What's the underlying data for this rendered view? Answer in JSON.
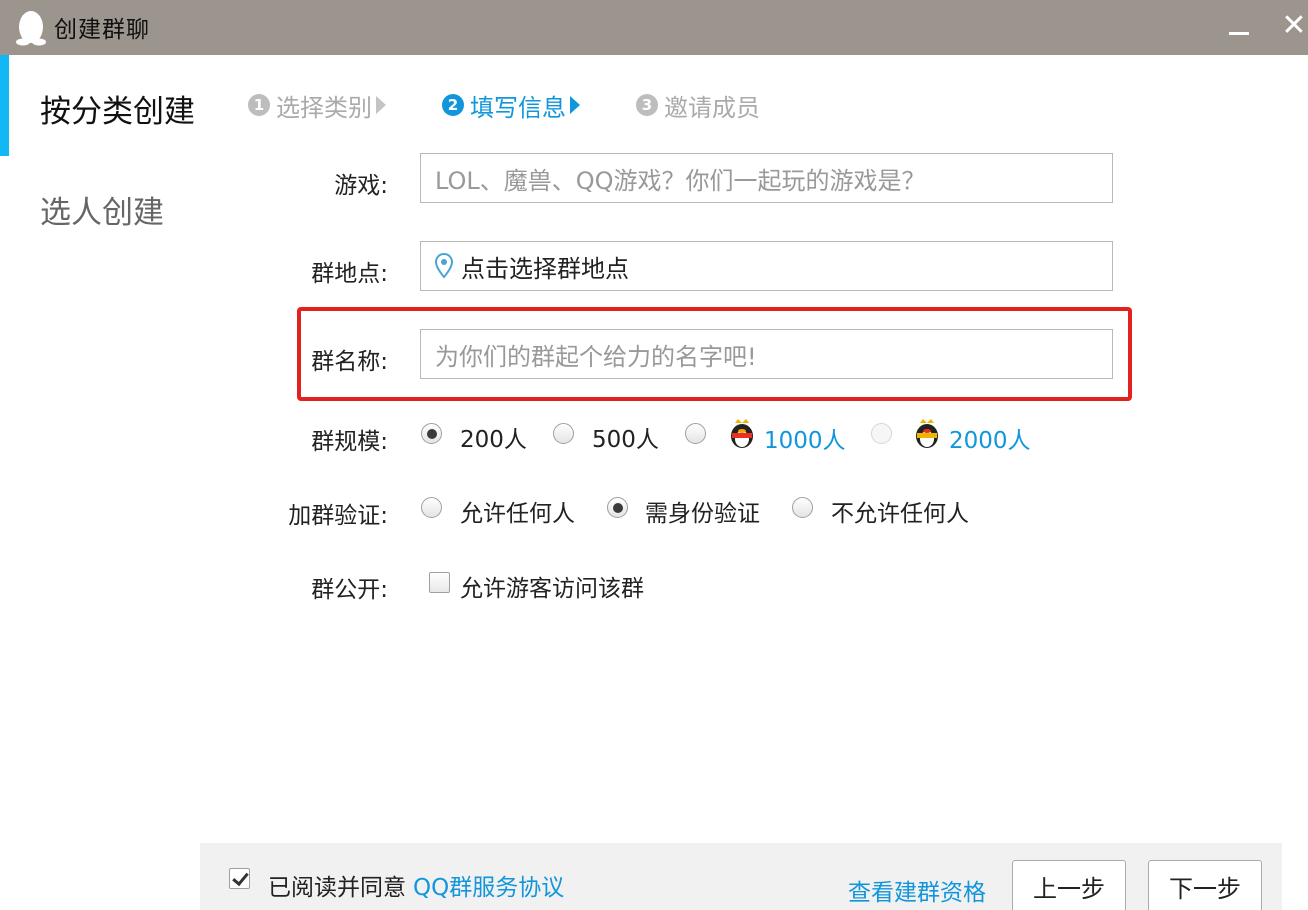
{
  "window": {
    "title": "创建群聊",
    "logo_icon": "qq-penguin-icon",
    "minimize_icon": "minimize-icon",
    "close_glyph": "✕"
  },
  "sidebar": {
    "items": [
      {
        "label": "按分类创建",
        "active": true
      },
      {
        "label": "选人创建",
        "active": false
      }
    ],
    "accent": "#12b7f5"
  },
  "steps": [
    {
      "num": "1",
      "label": "选择类别",
      "active": false
    },
    {
      "num": "2",
      "label": "填写信息",
      "active": true
    },
    {
      "num": "3",
      "label": "邀请成员",
      "active": false
    }
  ],
  "form": {
    "game": {
      "label": "游戏:",
      "placeholder": "LOL、魔兽、QQ游戏？你们一起玩的游戏是？"
    },
    "location": {
      "label": "群地点:",
      "value": "点击选择群地点",
      "icon": "location-pin-icon"
    },
    "name": {
      "label": "群名称:",
      "placeholder": "为你们的群起个给力的名字吧!"
    },
    "size": {
      "label": "群规模:",
      "options": [
        "200人",
        "500人",
        "1000人",
        "2000人"
      ],
      "selected": "200人"
    },
    "verify": {
      "label": "加群验证:",
      "options": [
        "允许任何人",
        "需身份验证",
        "不允许任何人"
      ],
      "selected": "需身份验证"
    },
    "public": {
      "label": "群公开:",
      "checkbox_label": "允许游客访问该群",
      "checked": false
    }
  },
  "footer": {
    "agree_text": "已阅读并同意",
    "agree_link": "QQ群服务协议",
    "agree_checked": true,
    "qualify_link": "查看建群资格",
    "prev_button": "上一步",
    "next_button": "下一步"
  },
  "colors": {
    "titlebar": "#9b958d",
    "link": "#1296db",
    "highlight": "#e3211e"
  }
}
